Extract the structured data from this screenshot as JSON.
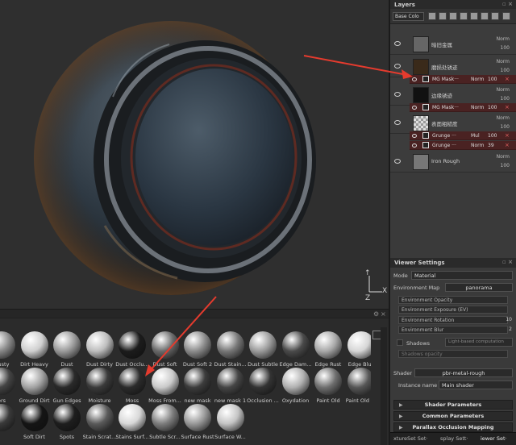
{
  "layers_panel": {
    "title": "Layers",
    "blend_select": "Base Colo",
    "layers": [
      {
        "name": "暗旧金属",
        "blend": "Norm",
        "opacity": "100",
        "thumb": "#666"
      },
      {
        "name": "磨损处锈迹",
        "blend": "Norm",
        "opacity": "100",
        "thumb": "#3a2a1a",
        "sub": {
          "name": "MG Mask···",
          "blend": "Norm",
          "opacity": "100"
        }
      },
      {
        "name": "边缘锈迹",
        "blend": "Norm",
        "opacity": "100",
        "thumb": "#111",
        "sub": {
          "name": "MG Mask···",
          "blend": "Norm",
          "opacity": "100"
        }
      },
      {
        "name": "表面粗糙度",
        "blend": "Norm",
        "opacity": "100",
        "thumb": "#ddd",
        "subs": [
          {
            "name": "Grunge ···",
            "blend": "Mul",
            "opacity": "100"
          },
          {
            "name": "Grunge ···",
            "blend": "Norm",
            "opacity": "39"
          }
        ]
      },
      {
        "name": "Iron Rough",
        "blend": "Norm",
        "opacity": "100",
        "thumb": "#777"
      }
    ]
  },
  "viewer_settings": {
    "title": "Viewer Settings",
    "mode_label": "Mode",
    "mode_value": "Material",
    "env_map_label": "Environment Map",
    "env_map_value": "panorama",
    "env_opacity": "Environment Opacity",
    "env_exposure": "Environment Exposure",
    "env_exposure_unit": "(EV)",
    "env_rotation": "Environment Rotation",
    "env_rotation_value": "10",
    "env_blur": "Environment Blur",
    "env_blur_value": "2",
    "shadows_label": "Shadows",
    "shadows_value": "Light-based computation",
    "shadows_opacity": "Shadows opacity",
    "shader_label": "Shader",
    "shader_value": "pbr-metal-rough",
    "instance_label": "Instance name",
    "instance_value": "Main shader",
    "sections": [
      "Shader Parameters",
      "Common Parameters",
      "Parallax Occlusion Mapping"
    ]
  },
  "bottom_tabs": [
    "xtureSet Set·",
    "splay Sett·",
    "iewer Set·"
  ],
  "axis": {
    "x": "X",
    "z": "Z"
  },
  "shelf": {
    "materials": [
      {
        "label": "Dusty",
        "color": "#8a8a8a"
      },
      {
        "label": "Dirt Heavy",
        "color": "#cfcfcf"
      },
      {
        "label": "Dust",
        "color": "#9a9a9a"
      },
      {
        "label": "Dust Dirty",
        "color": "#bdbdbd"
      },
      {
        "label": "Dust Occlu...",
        "color": "#1c1c1c"
      },
      {
        "label": "Dust Soft",
        "color": "#6a6a6a"
      },
      {
        "label": "Dust Soft 2",
        "color": "#8c8c8c"
      },
      {
        "label": "Dust Stain...",
        "color": "#777"
      },
      {
        "label": "Dust Subtle",
        "color": "#9b9b9b"
      },
      {
        "label": "Edge Dam...",
        "color": "#4a4a4a"
      },
      {
        "label": "Edge Rust",
        "color": "#a8a8a8"
      },
      {
        "label": "Edge Blur",
        "color": "#d6d6d6"
      },
      {
        "label": "ers",
        "color": "#444"
      },
      {
        "label": "Ground Dirt",
        "color": "#a3a3a3"
      },
      {
        "label": "Gun Edges",
        "color": "#2a2a2a"
      },
      {
        "label": "Moisture",
        "color": "#3a3a3a"
      },
      {
        "label": "Moss",
        "color": "#2b2b2b"
      },
      {
        "label": "Moss From...",
        "color": "#cacaca"
      },
      {
        "label": "new mask",
        "color": "#3c3c3c"
      },
      {
        "label": "new mask 1",
        "color": "#454545"
      },
      {
        "label": "Occlusion ...",
        "color": "#333"
      },
      {
        "label": "Oxydation",
        "color": "#b0b0b0"
      },
      {
        "label": "Paint Old",
        "color": "#6e6e6e"
      },
      {
        "label": "Paint Old ...",
        "color": "#565656"
      },
      {
        "label": "",
        "color": "#3a3a3a"
      },
      {
        "label": "Soft Dirt",
        "color": "#151515"
      },
      {
        "label": "Spots",
        "color": "#1e1e1e"
      },
      {
        "label": "Stain Scrat...",
        "color": "#5a5a5a"
      },
      {
        "label": "Stains Surf...",
        "color": "#d8d8d8"
      },
      {
        "label": "Subtle Scr...",
        "color": "#7d7d7d"
      },
      {
        "label": "Surface Rust",
        "color": "#999"
      },
      {
        "label": "Surface W...",
        "color": "#c4c4c4"
      }
    ]
  }
}
